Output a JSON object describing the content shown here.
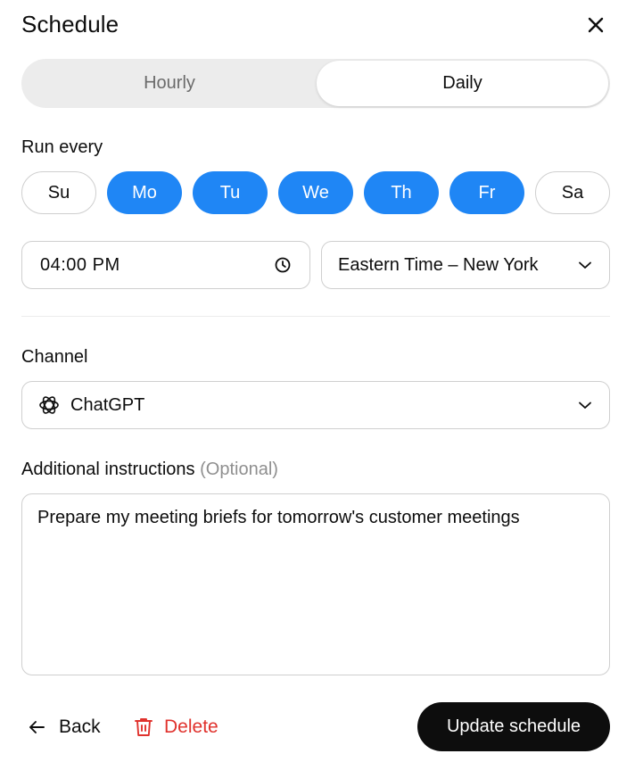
{
  "header": {
    "title": "Schedule",
    "close_icon": "close-icon"
  },
  "frequency": {
    "options": [
      {
        "label": "Hourly",
        "selected": false
      },
      {
        "label": "Daily",
        "selected": true
      }
    ]
  },
  "run_every": {
    "label": "Run every",
    "days": [
      {
        "label": "Su",
        "selected": false
      },
      {
        "label": "Mo",
        "selected": true
      },
      {
        "label": "Tu",
        "selected": true
      },
      {
        "label": "We",
        "selected": true
      },
      {
        "label": "Th",
        "selected": true
      },
      {
        "label": "Fr",
        "selected": true
      },
      {
        "label": "Sa",
        "selected": false
      }
    ]
  },
  "time": {
    "value": "04:00 PM",
    "icon": "clock-icon"
  },
  "timezone": {
    "value": "Eastern Time – New York",
    "icon": "chevron-down-icon"
  },
  "channel": {
    "label": "Channel",
    "value": "ChatGPT",
    "icon": "chatgpt-logo-icon"
  },
  "instructions": {
    "label": "Additional instructions",
    "optional": "(Optional)",
    "value": "Prepare my meeting briefs for tomorrow's customer meetings"
  },
  "footer": {
    "back_label": "Back",
    "delete_label": "Delete",
    "update_label": "Update schedule"
  },
  "colors": {
    "accent": "#1f86f5",
    "danger": "#e0322d",
    "primary_button": "#0d0d0d"
  }
}
